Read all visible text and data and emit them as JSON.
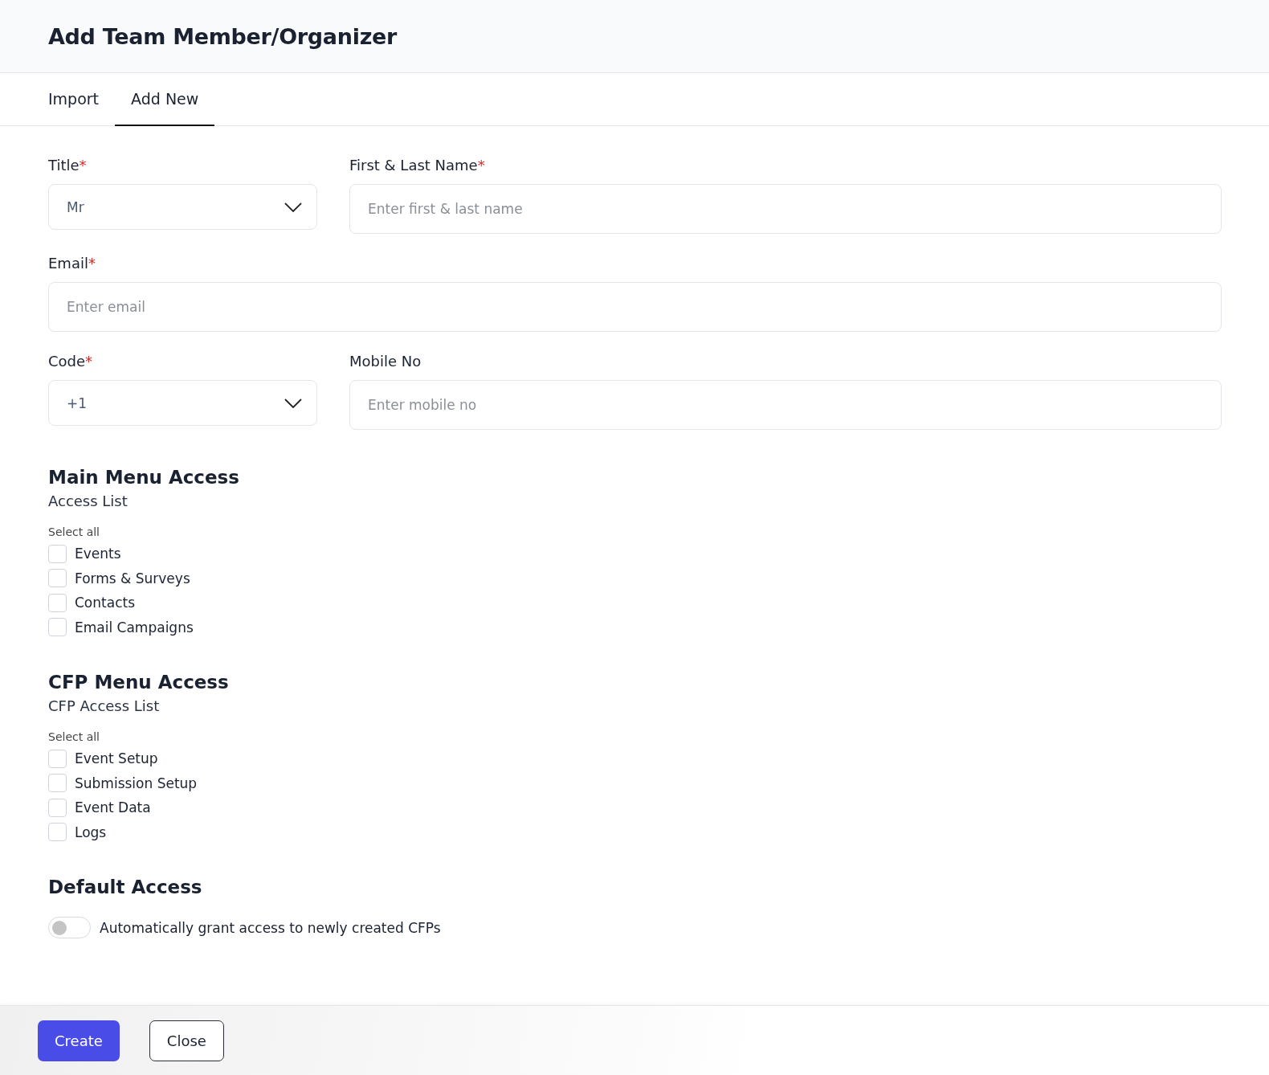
{
  "header": {
    "title": "Add Team Member/Organizer"
  },
  "tabs": [
    {
      "label": "Import",
      "selected": false
    },
    {
      "label": "Add New",
      "selected": true
    }
  ],
  "form": {
    "rows": [
      [
        {
          "kind": "select",
          "label": "Title",
          "required_mark": "*",
          "value": "Mr"
        },
        {
          "kind": "input",
          "label": "First & Last Name",
          "required_mark": "*",
          "placeholder": "Enter first & last name"
        }
      ],
      [
        {
          "kind": "input",
          "label": "Email",
          "required_mark": "*",
          "placeholder": "Enter email"
        }
      ],
      [
        {
          "kind": "select",
          "label": "Code",
          "required_mark": "*",
          "value": "+1"
        },
        {
          "kind": "input",
          "label": "Mobile No",
          "placeholder": "Enter mobile no"
        }
      ]
    ]
  },
  "access_sections": [
    {
      "heading": "Main Menu Access",
      "subheading": "Access List",
      "select_all": "Select all",
      "items": [
        {
          "label": "Events",
          "checked": false
        },
        {
          "label": "Forms & Surveys",
          "checked": false
        },
        {
          "label": "Contacts",
          "checked": false
        },
        {
          "label": "Email Campaigns",
          "checked": false
        }
      ]
    },
    {
      "heading": "CFP Menu Access",
      "subheading": "CFP Access List",
      "select_all": "Select all",
      "items": [
        {
          "label": "Event Setup",
          "checked": false
        },
        {
          "label": "Submission Setup",
          "checked": false
        },
        {
          "label": "Event Data",
          "checked": false
        },
        {
          "label": "Logs",
          "checked": false
        }
      ]
    }
  ],
  "default_access": {
    "heading": "Default Access",
    "toggle": {
      "label": "Automatically grant access to newly created CFPs",
      "on": false
    }
  },
  "footer": {
    "buttons": [
      {
        "label": "Create",
        "kind": "primary"
      },
      {
        "label": "Close",
        "kind": "secondary"
      }
    ]
  }
}
